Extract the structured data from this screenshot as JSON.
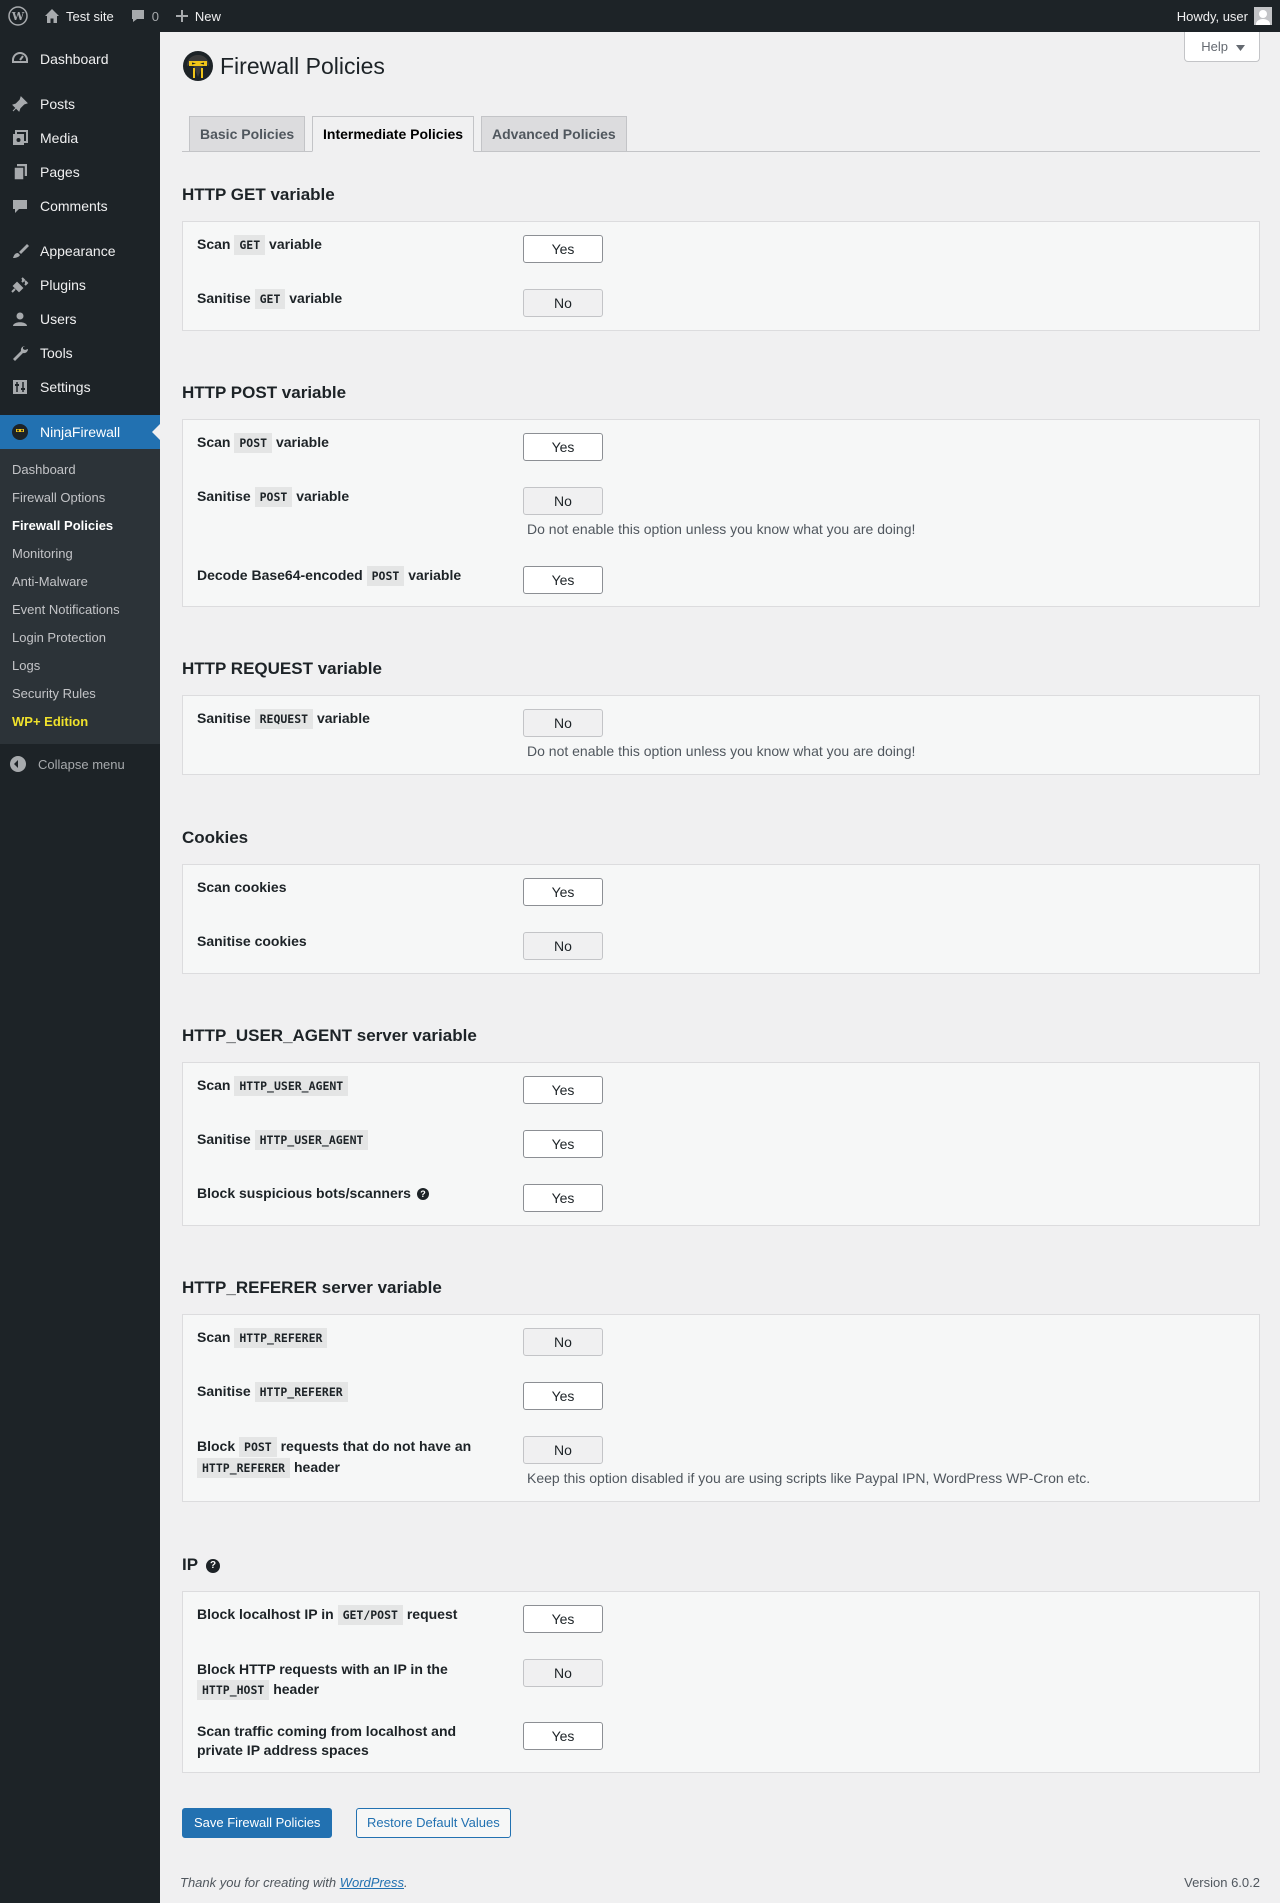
{
  "admin_bar": {
    "site_name": "Test site",
    "comments_count": "0",
    "new_label": "New",
    "howdy": "Howdy, user"
  },
  "sidebar": {
    "items": [
      {
        "label": "Dashboard",
        "icon": "dashboard-icon"
      },
      {
        "label": "Posts",
        "icon": "pin-icon"
      },
      {
        "label": "Media",
        "icon": "media-icon"
      },
      {
        "label": "Pages",
        "icon": "pages-icon"
      },
      {
        "label": "Comments",
        "icon": "comment-icon"
      },
      {
        "label": "Appearance",
        "icon": "brush-icon"
      },
      {
        "label": "Plugins",
        "icon": "plug-icon"
      },
      {
        "label": "Users",
        "icon": "user-icon"
      },
      {
        "label": "Tools",
        "icon": "wrench-icon"
      },
      {
        "label": "Settings",
        "icon": "settings-icon"
      },
      {
        "label": "NinjaFirewall",
        "icon": "ninja-icon"
      }
    ],
    "submenu": [
      "Dashboard",
      "Firewall Options",
      "Firewall Policies",
      "Monitoring",
      "Anti-Malware",
      "Event Notifications",
      "Login Protection",
      "Logs",
      "Security Rules",
      "WP+ Edition"
    ],
    "collapse_label": "Collapse menu"
  },
  "page": {
    "title": "Firewall Policies",
    "help_label": "Help"
  },
  "tabs": [
    "Basic Policies",
    "Intermediate Policies",
    "Advanced Policies"
  ],
  "sections": {
    "get": {
      "title": "HTTP GET variable",
      "rows": [
        {
          "pre": "Scan",
          "code": "GET",
          "post": "variable",
          "value": "Yes"
        },
        {
          "pre": "Sanitise",
          "code": "GET",
          "post": "variable",
          "value": "No"
        }
      ]
    },
    "post": {
      "title": "HTTP POST variable",
      "rows": [
        {
          "pre": "Scan",
          "code": "POST",
          "post": "variable",
          "value": "Yes"
        },
        {
          "pre": "Sanitise",
          "code": "POST",
          "post": "variable",
          "value": "No",
          "desc": "Do not enable this option unless you know what you are doing!"
        },
        {
          "pre": "Decode Base64-encoded",
          "code": "POST",
          "post": "variable",
          "value": "Yes"
        }
      ]
    },
    "request": {
      "title": "HTTP REQUEST variable",
      "rows": [
        {
          "pre": "Sanitise",
          "code": "REQUEST",
          "post": "variable",
          "value": "No",
          "desc": "Do not enable this option unless you know what you are doing!"
        }
      ]
    },
    "cookies": {
      "title": "Cookies",
      "rows": [
        {
          "label": "Scan cookies",
          "value": "Yes"
        },
        {
          "label": "Sanitise cookies",
          "value": "No"
        }
      ]
    },
    "user_agent": {
      "title": "HTTP_USER_AGENT server variable",
      "rows": [
        {
          "pre": "Scan",
          "code": "HTTP_USER_AGENT",
          "value": "Yes"
        },
        {
          "pre": "Sanitise",
          "code": "HTTP_USER_AGENT",
          "value": "Yes"
        },
        {
          "label": "Block suspicious bots/scanners",
          "value": "Yes"
        }
      ]
    },
    "referer": {
      "title": "HTTP_REFERER server variable",
      "rows": [
        {
          "pre": "Scan",
          "code": "HTTP_REFERER",
          "value": "No"
        },
        {
          "pre": "Sanitise",
          "code": "HTTP_REFERER",
          "value": "Yes"
        },
        {
          "pre": "Block",
          "code": "POST",
          "post": "requests that do not have an",
          "code2": "HTTP_REFERER",
          "post2": "header",
          "value": "No",
          "desc": "Keep this option disabled if you are using scripts like Paypal IPN, WordPress WP-Cron etc."
        }
      ]
    },
    "ip": {
      "title": "IP",
      "rows": [
        {
          "pre": "Block localhost IP in",
          "code": "GET/POST",
          "post": "request",
          "value": "Yes"
        },
        {
          "pre": "Block HTTP requests with an IP in the",
          "code": "HTTP_HOST",
          "post": "header",
          "value": "No"
        },
        {
          "line1": "Scan traffic coming from localhost and",
          "line2": "private IP address spaces",
          "value": "Yes"
        }
      ]
    }
  },
  "buttons": {
    "save": "Save Firewall Policies",
    "restore": "Restore Default Values"
  },
  "footer": {
    "thanks_pre": "Thank you for creating with",
    "thanks_link": "WordPress",
    "thanks_post": ".",
    "version": "Version 6.0.2"
  },
  "colors": {
    "admin_bg": "#1d2327",
    "accent": "#2271b1",
    "wp_plus": "#f0e22c"
  }
}
